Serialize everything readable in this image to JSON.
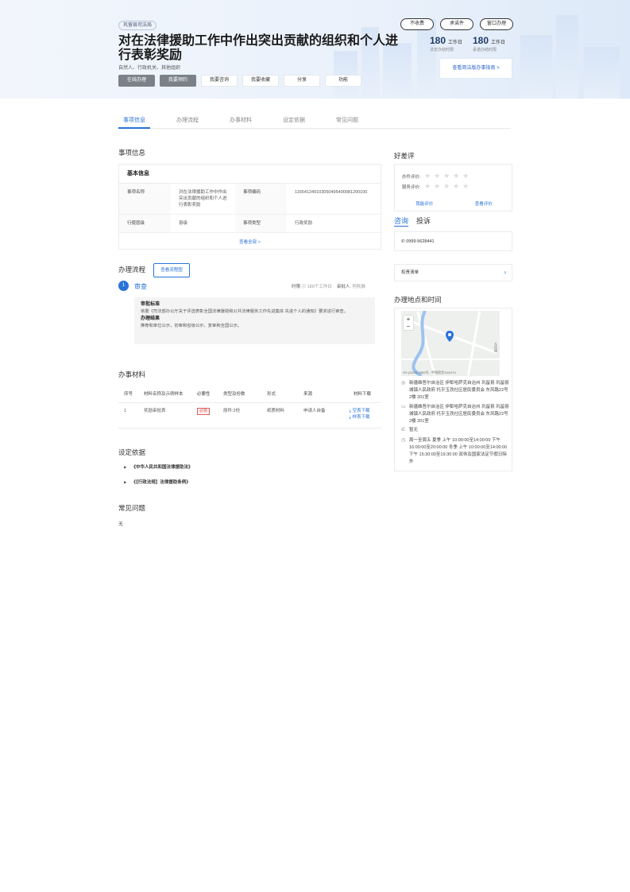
{
  "header": {
    "dept": "巩留县司法局",
    "title": "对在法律援助工作中作出突出贡献的组织和个人进行表彰奖励",
    "subjects": "自然人、行政机关、其他组织",
    "actions": [
      "在线办理",
      "我要预约",
      "我要咨询",
      "我要收藏",
      "分享",
      "功能"
    ],
    "tags": [
      "不收费",
      "承诺件",
      "窗口办理"
    ],
    "stats": [
      {
        "num": "180",
        "unit": "工作日",
        "label": "法定办结时限"
      },
      {
        "num": "180",
        "unit": "工作日",
        "label": "承诺办结时限"
      }
    ],
    "guide": "查看简洁版办事指南 >"
  },
  "tabs": [
    "事项信息",
    "办理流程",
    "办事材料",
    "设定依据",
    "常见问题"
  ],
  "item_info": {
    "heading": "事项信息",
    "card_title": "基本信息",
    "rows": [
      {
        "k1": "事项名称",
        "v1": "对在法律援助工作中作出突出贡献的组织和个人进行表彰奖励",
        "k2": "事项编码",
        "v2": "116541240103050495400081200100"
      },
      {
        "k1": "行使层级",
        "v1": "县级",
        "k2": "事项类型",
        "v2": "行政奖励"
      }
    ],
    "view_all": "查看全部 >"
  },
  "rating": {
    "heading": "好差评",
    "rows": [
      "办件评价:",
      "服务评价:"
    ],
    "links": [
      "我能评价",
      "查看评价"
    ]
  },
  "consult": {
    "tabs": [
      "咨询",
      "投诉"
    ],
    "phone": "0999-5628441"
  },
  "power_list": "权责清单",
  "location": {
    "heading": "办理地点和时间",
    "map_zoom": [
      "+",
      "−"
    ],
    "map_credit": "GS (2023) 1562号 - 甲测资字1111074",
    "map_street": "东风路",
    "rows": [
      {
        "icon": "location-icon",
        "text": "新疆维吾尔自治区 伊犁哈萨克自治州 巩留县 巩留县城镇人民政府 托乎玉孜社区居民委员会 东风路22号 2楼 201室"
      },
      {
        "icon": "window-icon",
        "text": "新疆维吾尔自治区 伊犁哈萨克自治州 巩留县 巩留县城镇人民政府 托乎玉孜社区居民委员会 东风路22号 2楼 201室"
      },
      {
        "icon": "phone-icon",
        "text": "暂无"
      },
      {
        "icon": "clock-icon",
        "text": "周一至周五 夏季 上午 10:00:00至14:00:00 下午 16:00:00至20:00:00 冬季 上午 10:00:00至14:00:00 下午 15:30:00至19:30:00 双休及国家法定节假日除外"
      }
    ]
  },
  "process": {
    "heading": "办理流程",
    "view_chart": "查看流程图",
    "step": {
      "num": "1",
      "name": "审查",
      "time_label": "时限",
      "time_value": "180个工作日",
      "reviewer_label": "审批人:",
      "reviewer_value": "阿秋脉",
      "std_title": "审批标准",
      "std_text": "依据《司法部办公厅关于评选表彰全国法律援助和公共法律服务工作先进集体 先进个人的通知》要求进行审查。",
      "result_title": "办理结果",
      "result_text": "推荐和单位公示，初审和省级公示，复审和全国公示。"
    }
  },
  "materials": {
    "heading": "办事材料",
    "headers": [
      "序号",
      "材料名称及示例样本",
      "必要性",
      "类型及份数",
      "形式",
      "来源",
      "材料下载"
    ],
    "rows": [
      {
        "no": "1",
        "name": "奖励审批表",
        "required": "必要",
        "type": "原件:2份",
        "form": "纸质材料",
        "source": "申请人自备",
        "dl1": "空表下载",
        "dl2": "样表下载"
      }
    ]
  },
  "basis": {
    "heading": "设定依据",
    "items": [
      "《中华人民共和国法律援助法》",
      "《【行政法规】法律援助条例》"
    ]
  },
  "faq": {
    "heading": "常见问题",
    "none": "无"
  }
}
